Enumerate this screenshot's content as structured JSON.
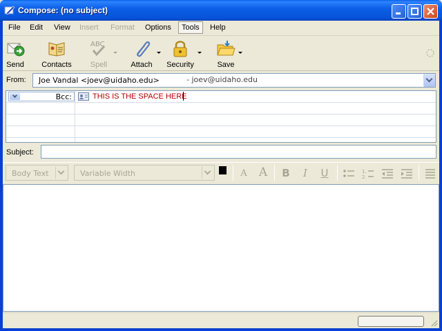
{
  "window": {
    "title": "Compose: (no subject)"
  },
  "menubar": {
    "items": [
      {
        "label": "File",
        "enabled": true
      },
      {
        "label": "Edit",
        "enabled": true
      },
      {
        "label": "View",
        "enabled": true
      },
      {
        "label": "Insert",
        "enabled": false
      },
      {
        "label": "Format",
        "enabled": false
      },
      {
        "label": "Options",
        "enabled": true
      },
      {
        "label": "Tools",
        "enabled": true,
        "active": true
      },
      {
        "label": "Help",
        "enabled": true
      }
    ]
  },
  "toolbar": {
    "send": "Send",
    "contacts": "Contacts",
    "spell": "Spell",
    "spell_icon_text": "ABC",
    "attach": "Attach",
    "security": "Security",
    "save": "Save"
  },
  "header": {
    "from_label": "From:",
    "from_value": "Joe Vandal <joev@uidaho.edu>",
    "from_identity": "- joev@uidaho.edu",
    "recipients": [
      {
        "type": "Bcc:",
        "address": "THIS IS THE SPACE HERE"
      }
    ],
    "subject_label": "Subject:",
    "subject_value": ""
  },
  "format": {
    "paragraph_style": "Body Text",
    "font": "Variable Width",
    "bold": "B",
    "italic": "I",
    "underline": "U",
    "smaller_text": "A",
    "larger_text": "A",
    "text_color": "#000000",
    "background_color": "#ffffff"
  },
  "colors": {
    "titlebar": "#0553d9",
    "address_text": "#b10000",
    "disabled_text": "#a7a594"
  }
}
